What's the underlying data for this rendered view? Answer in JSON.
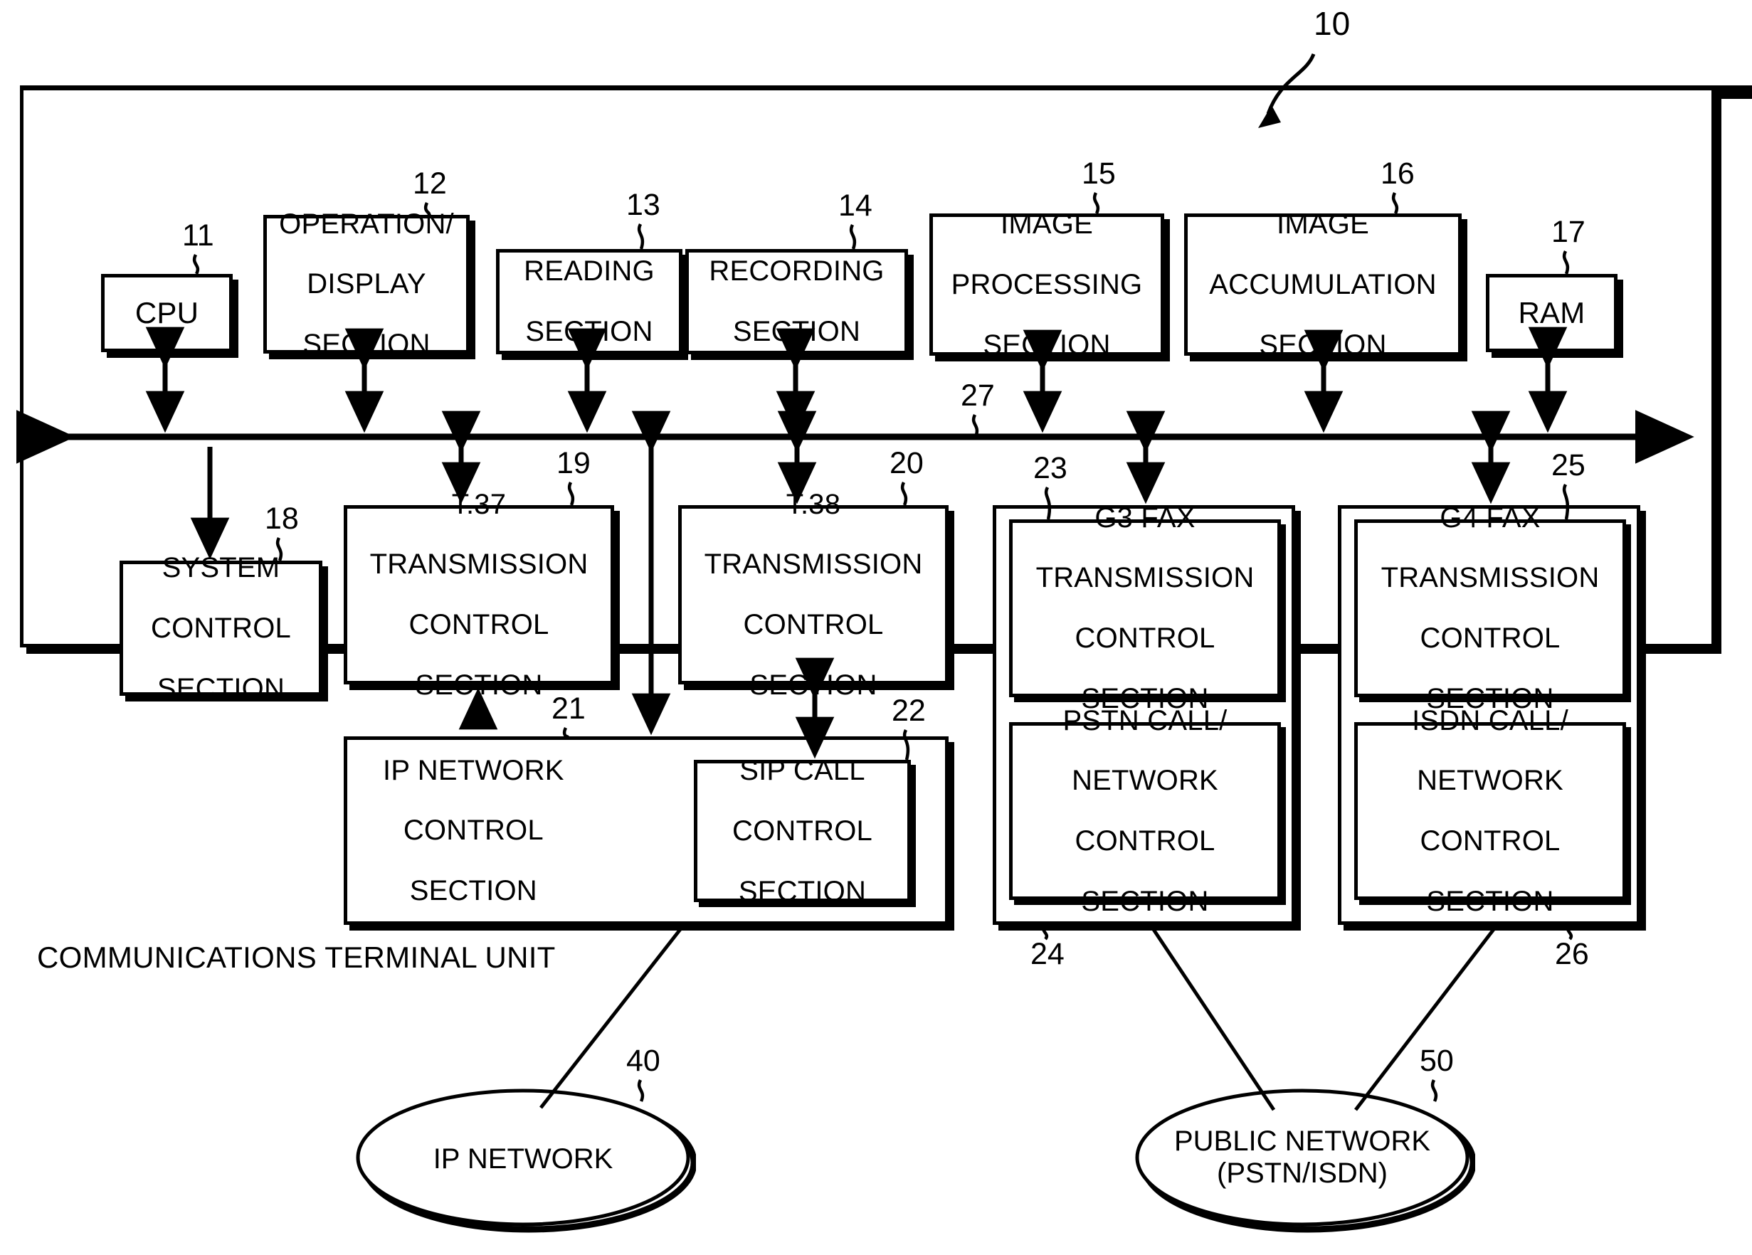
{
  "figure": {
    "top_reference": "10",
    "unit_label": "COMMUNICATIONS TERMINAL UNIT",
    "bus_reference": "27"
  },
  "blocks": [
    {
      "id": "cpu",
      "ref": "11",
      "lines": [
        "CPU"
      ]
    },
    {
      "id": "operation",
      "ref": "12",
      "lines": [
        "OPERATION/",
        "DISPLAY",
        "SECTION"
      ]
    },
    {
      "id": "reading",
      "ref": "13",
      "lines": [
        "READING",
        "SECTION"
      ]
    },
    {
      "id": "recording",
      "ref": "14",
      "lines": [
        "RECORDING",
        "SECTION"
      ]
    },
    {
      "id": "imageproc",
      "ref": "15",
      "lines": [
        "IMAGE",
        "PROCESSING",
        "SECTION"
      ]
    },
    {
      "id": "imageaccum",
      "ref": "16",
      "lines": [
        "IMAGE",
        "ACCUMULATION",
        "SECTION"
      ]
    },
    {
      "id": "ram",
      "ref": "17",
      "lines": [
        "RAM"
      ]
    },
    {
      "id": "syscontrol",
      "ref": "18",
      "lines": [
        "SYSTEM",
        "CONTROL",
        "SECTION"
      ]
    },
    {
      "id": "t37",
      "ref": "19",
      "lines": [
        "T.37",
        "TRANSMISSION",
        "CONTROL",
        "SECTION"
      ]
    },
    {
      "id": "t38",
      "ref": "20",
      "lines": [
        "T.38",
        "TRANSMISSION",
        "CONTROL",
        "SECTION"
      ]
    },
    {
      "id": "ipnetwork",
      "ref": "21",
      "lines": [
        "IP NETWORK",
        "CONTROL",
        "SECTION"
      ]
    },
    {
      "id": "sipcall",
      "ref": "22",
      "lines": [
        "SIP CALL",
        "CONTROL",
        "SECTION"
      ]
    },
    {
      "id": "g3fax",
      "ref": "23",
      "lines": [
        "G3 FAX",
        "TRANSMISSION",
        "CONTROL",
        "SECTION"
      ]
    },
    {
      "id": "pstncall",
      "ref": "24",
      "lines": [
        "PSTN CALL/",
        "NETWORK",
        "CONTROL",
        "SECTION"
      ]
    },
    {
      "id": "g4fax",
      "ref": "25",
      "lines": [
        "G4 FAX",
        "TRANSMISSION",
        "CONTROL",
        "SECTION"
      ]
    },
    {
      "id": "isdncall",
      "ref": "26",
      "lines": [
        "ISDN CALL/",
        "NETWORK",
        "CONTROL",
        "SECTION"
      ]
    }
  ],
  "networks": [
    {
      "id": "ipnet",
      "ref": "40",
      "lines": [
        "IP NETWORK"
      ]
    },
    {
      "id": "publicnet",
      "ref": "50",
      "lines": [
        "PUBLIC NETWORK",
        "(PSTN/ISDN)"
      ]
    }
  ],
  "text": {
    "cpu_l1": "CPU",
    "operation_l1": "OPERATION/",
    "operation_l2": "DISPLAY",
    "operation_l3": "SECTION",
    "reading_l1": "READING",
    "reading_l2": "SECTION",
    "recording_l1": "RECORDING",
    "recording_l2": "SECTION",
    "imageproc_l1": "IMAGE",
    "imageproc_l2": "PROCESSING",
    "imageproc_l3": "SECTION",
    "imageaccum_l1": "IMAGE",
    "imageaccum_l2": "ACCUMULATION",
    "imageaccum_l3": "SECTION",
    "ram_l1": "RAM",
    "syscontrol_l1": "SYSTEM",
    "syscontrol_l2": "CONTROL",
    "syscontrol_l3": "SECTION",
    "t37_l1": "T.37",
    "t37_l2": "TRANSMISSION",
    "t37_l3": "CONTROL",
    "t37_l4": "SECTION",
    "t38_l1": "T.38",
    "t38_l2": "TRANSMISSION",
    "t38_l3": "CONTROL",
    "t38_l4": "SECTION",
    "ipnetwork_l1": "IP NETWORK",
    "ipnetwork_l2": "CONTROL",
    "ipnetwork_l3": "SECTION",
    "sipcall_l1": "SIP CALL",
    "sipcall_l2": "CONTROL",
    "sipcall_l3": "SECTION",
    "g3fax_l1": "G3 FAX",
    "g3fax_l2": "TRANSMISSION",
    "g3fax_l3": "CONTROL",
    "g3fax_l4": "SECTION",
    "pstncall_l1": "PSTN CALL/",
    "pstncall_l2": "NETWORK",
    "pstncall_l3": "CONTROL",
    "pstncall_l4": "SECTION",
    "g4fax_l1": "G4 FAX",
    "g4fax_l2": "TRANSMISSION",
    "g4fax_l3": "CONTROL",
    "g4fax_l4": "SECTION",
    "isdncall_l1": "ISDN CALL/",
    "isdncall_l2": "NETWORK",
    "isdncall_l3": "CONTROL",
    "isdncall_l4": "SECTION",
    "ipnet_l1": "IP NETWORK",
    "publicnet_l1": "PUBLIC NETWORK",
    "publicnet_l2": "(PSTN/ISDN)"
  },
  "refs": {
    "r10": "10",
    "r11": "11",
    "r12": "12",
    "r13": "13",
    "r14": "14",
    "r15": "15",
    "r16": "16",
    "r17": "17",
    "r18": "18",
    "r19": "19",
    "r20": "20",
    "r21": "21",
    "r22": "22",
    "r23": "23",
    "r24": "24",
    "r25": "25",
    "r26": "26",
    "r27": "27",
    "r40": "40",
    "r50": "50"
  },
  "colors": {
    "ink": "#000000",
    "paper": "#ffffff"
  }
}
